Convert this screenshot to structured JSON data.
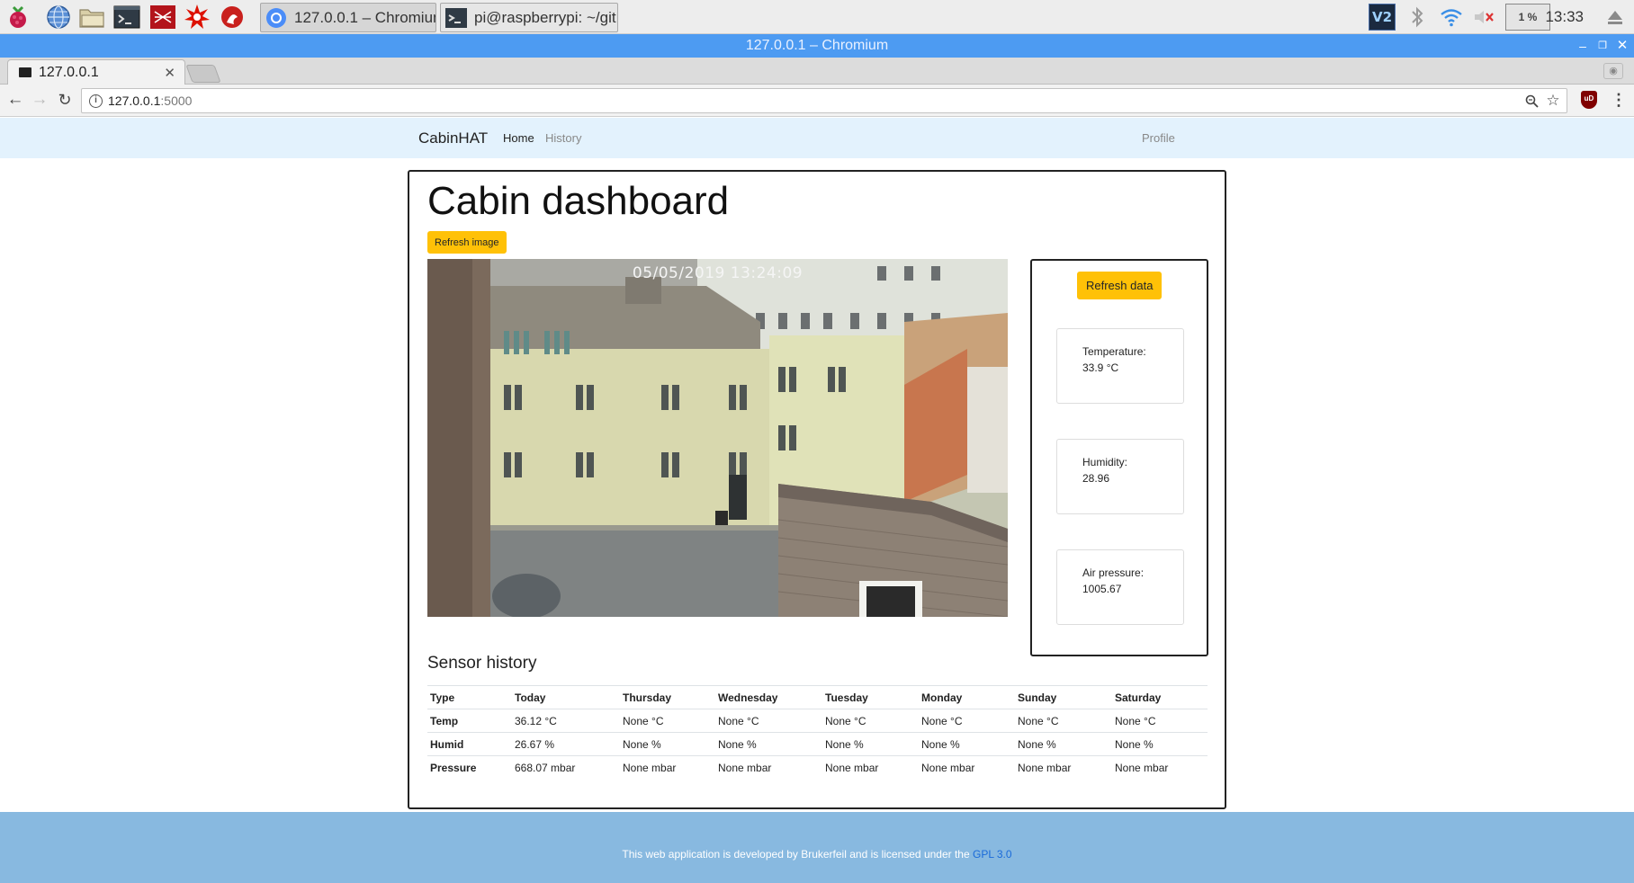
{
  "taskbar": {
    "tasks": [
      {
        "label": "127.0.0.1 – Chromium",
        "active": true
      },
      {
        "label": "pi@raspberrypi: ~/git...",
        "active": false
      }
    ],
    "cpu_usage": "1 %",
    "clock": "13:33"
  },
  "window": {
    "title": "127.0.0.1 – Chromium"
  },
  "browser": {
    "tab_title": "127.0.0.1",
    "url_host": "127.0.0.1",
    "url_port": ":5000"
  },
  "navbar": {
    "brand": "CabinHAT",
    "links": [
      "Home",
      "History"
    ],
    "profile": "Profile"
  },
  "dashboard": {
    "title": "Cabin dashboard",
    "refresh_image_label": "Refresh image",
    "camera_timestamp": "05/05/2019 13:24:09",
    "refresh_data_label": "Refresh data",
    "sensors": [
      {
        "label": "Temperature:",
        "value": "33.9 °C"
      },
      {
        "label": "Humidity:",
        "value": "28.96"
      },
      {
        "label": "Air pressure:",
        "value": "1005.67"
      }
    ]
  },
  "history": {
    "title": "Sensor history",
    "columns": [
      "Type",
      "Today",
      "Thursday",
      "Wednesday",
      "Tuesday",
      "Monday",
      "Sunday",
      "Saturday"
    ],
    "rows": [
      [
        "Temp",
        "36.12 °C",
        "None °C",
        "None °C",
        "None °C",
        "None °C",
        "None °C",
        "None °C"
      ],
      [
        "Humid",
        "26.67 %",
        "None %",
        "None %",
        "None %",
        "None %",
        "None %",
        "None %"
      ],
      [
        "Pressure",
        "668.07 mbar",
        "None mbar",
        "None mbar",
        "None mbar",
        "None mbar",
        "None mbar",
        "None mbar"
      ]
    ]
  },
  "footer": {
    "text": "This web application is developed by Brukerfeil and is licensed under the ",
    "link": "GPL 3.0"
  },
  "colors": {
    "window_titlebar": "#4d9bf2",
    "navbar_bg": "#e3f2fd",
    "button_yellow": "#ffc107",
    "footer_bg": "#88b9e0",
    "footer_link": "#1a6ad9"
  }
}
